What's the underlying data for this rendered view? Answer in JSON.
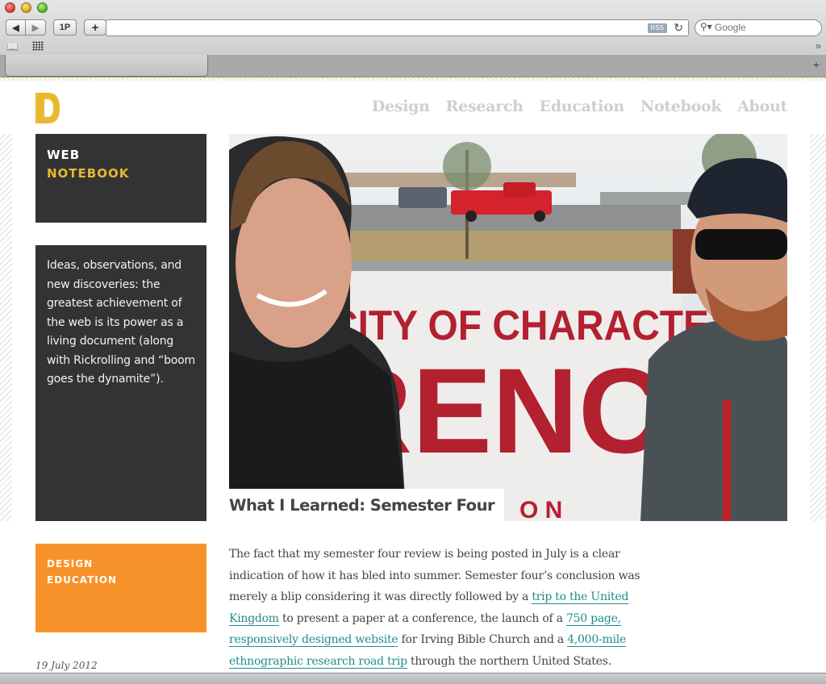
{
  "browser": {
    "back_label": "◀",
    "forward_label": "▶",
    "onepassword_label": "1P",
    "add_label": "+",
    "url": "",
    "rss_label": "RSS",
    "reload_glyph": "↻",
    "search_glyph": "⚲▾",
    "search_placeholder": "Google",
    "bookmarks_glyph": "📖",
    "overflow_glyph": "»",
    "new_tab_glyph": "+"
  },
  "site": {
    "nav": [
      {
        "label": "Design"
      },
      {
        "label": "Research"
      },
      {
        "label": "Education"
      },
      {
        "label": "Notebook"
      },
      {
        "label": "About"
      }
    ],
    "accent_color": "#e8b92e",
    "orange_color": "#f7922a",
    "link_color": "#1f8c8c"
  },
  "sidebar": {
    "title_line1": "WEB",
    "title_line2": "NOTEBOOK",
    "description": "Ideas, observations, and new discoveries: the greatest achievement of the web is its power as a living document (along with Rickrolling and “boom goes the dynamite”).",
    "category_line1": "DESIGN",
    "category_line2": "EDUCATION",
    "date": "19 July 2012"
  },
  "post": {
    "title": "What I Learned: Semester Four",
    "banner_text_1": "CITY OF CHARACTE",
    "banner_text_2": "RENC",
    "banner_text_3": "O N",
    "body": {
      "t1": "The fact that my semester four review is being posted in July is a clear indication of how it has bled into summer. Semester four’s conclusion was merely a blip considering it was directly followed by a ",
      "link1": "trip to the United Kingdom",
      "t2": " to present a paper at a conference, the launch of a ",
      "link2": "750 page, responsively designed website",
      "t3": " for Irving Bible Church and a ",
      "link3": "4,000-mile ethnographic research road trip",
      "t4": " through the northern United States. Though while its “thunder” may have been effectively"
    }
  }
}
